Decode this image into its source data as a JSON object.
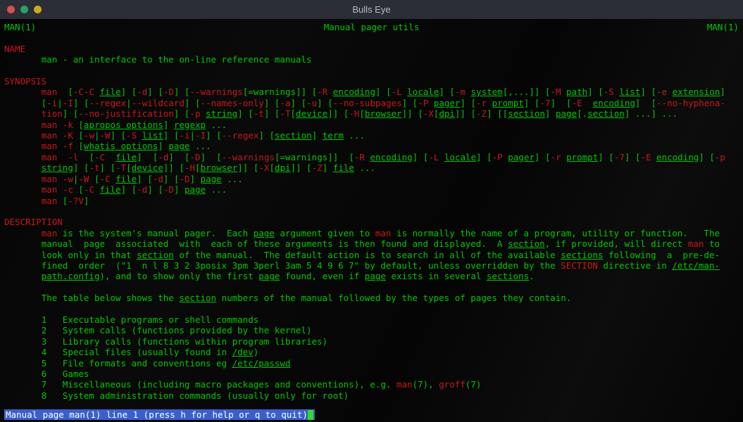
{
  "window": {
    "title": "Bulls Eye"
  },
  "header": {
    "left": "MAN(1)",
    "center": "Manual pager utils",
    "right": "MAN(1)"
  },
  "sections": {
    "name": {
      "title": "NAME",
      "body": "man - an interface to the on-line reference manuals"
    },
    "synopsis": {
      "title": "SYNOPSIS"
    },
    "description": {
      "title": "DESCRIPTION"
    }
  },
  "syn": {
    "man": "man",
    "file": "file",
    "d": "-d",
    "D": "-D",
    "warnings": "--warnings",
    "eqwarn": "=warnings",
    "R": "-R",
    "encoding": "encoding",
    "L": "-L",
    "locale": "locale",
    "m": "-m",
    "system": "system",
    "M": "-M",
    "path": "path",
    "S": "-S",
    "list": "list",
    "e": "-e",
    "extension": "extension",
    "i": "-i",
    "I": "-I",
    "regex": "--regex",
    "wildcard": "--wildcard",
    "namesonly": "--names-only",
    "a": "-a",
    "u": "-u",
    "nosubpages": "--no-subpages",
    "P": "-P",
    "pager": "pager",
    "rflag": "-r",
    "prompt": "prompt",
    "seven": "-7",
    "E": "-E",
    "nohyphen": "--no-hyphena-",
    "tion": "tion",
    "nojustify": "--no-justification",
    "p": "-p",
    "string": "string",
    "t": "-t",
    "T": "-T",
    "device": "device",
    "H": "-H",
    "browser": "browser",
    "X": "-X",
    "dpi": "dpi",
    "Z": "-Z",
    "section": "section",
    "page": "page",
    "dots": "...",
    "k": "-k",
    "apropos": "apropos options",
    "regexp": "regexp",
    "K": "-K",
    "w": "-w",
    "W": "-W",
    "term": "term",
    "f": "-f",
    "whatis": "whatis options",
    "l": "-l",
    "c": "-c",
    "C": "-C",
    "qv": "-?V",
    "lbrack": "[",
    "rbrack": "]",
    "comma": ",",
    "pipe": "|"
  },
  "desc": {
    "p1_1": "man",
    "p1_2": " is the system's manual pager.  Each ",
    "p1_3": "page",
    "p1_4": " argument given to ",
    "p1_5": "man",
    "p1_6": " is normally the name of a program, utility or function.   The",
    "p2_1": "manual  page  associated  with  each of these arguments is then found and displayed.  A ",
    "p2_2": "section",
    "p2_3": ", if provided, will direct ",
    "p2_4": "man",
    "p2_5": " to",
    "p3_1": "look only in that ",
    "p3_2": "section",
    "p3_3": " of the manual.  The default action is to search in all of the available ",
    "p3_4": "sections",
    "p3_5": " following  a  pre-de-",
    "p4_1": "fined  order  (\"1  n l 8 3 2 3posix 3pm 3perl 3am 5 4 9 6 7\" by default, unless overridden by the ",
    "p4_2": "SECTION",
    "p4_3": " directive in ",
    "p4_4": "/etc/man-",
    "p5_1": "path.config",
    "p5_2": "), and to show only the first ",
    "p5_3": "page",
    "p5_4": " found, even if ",
    "p5_5": "page",
    "p5_6": " exists in several ",
    "p5_7": "sections",
    "p5_8": ".",
    "p6_1": "The table below shows the ",
    "p6_2": "section",
    "p6_3": " numbers of the manual followed by the types of pages they contain."
  },
  "list": [
    {
      "n": "1",
      "t": "Executable programs or shell commands"
    },
    {
      "n": "2",
      "t": "System calls (functions provided by the kernel)"
    },
    {
      "n": "3",
      "t": "Library calls (functions within program libraries)"
    },
    {
      "n": "4",
      "t": "Special files (usually found in ",
      "tail": "/dev",
      ")": ")"
    },
    {
      "n": "5",
      "t": "File formats and conventions eg ",
      "tail": "/etc/passwd"
    },
    {
      "n": "6",
      "t": "Games"
    },
    {
      "n": "7",
      "t": "Miscellaneous (including macro packages and conventions), e.g. ",
      "tail1": "man",
      "mid": "(7), ",
      "tail2": "groff",
      "end": "(7)"
    },
    {
      "n": "8",
      "t": "System administration commands (usually only for root)"
    }
  ],
  "status": " Manual page man(1) line 1 (press h for help or q to quit)"
}
